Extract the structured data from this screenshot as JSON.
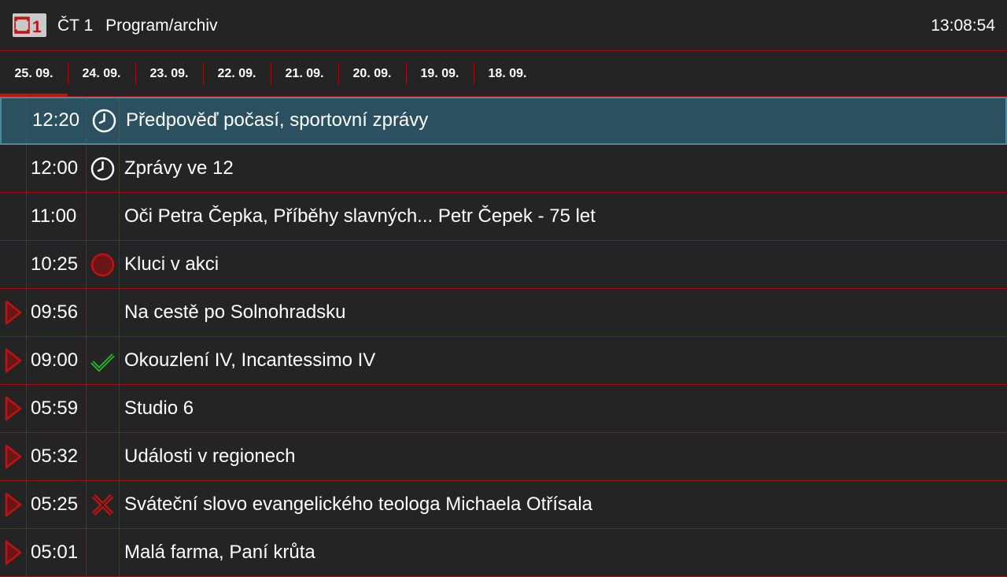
{
  "header": {
    "logo_alt": "ČT1 logo",
    "channel": "ČT 1",
    "section": "Program/archiv",
    "clock": "13:08:54"
  },
  "tabs": [
    {
      "label": "25. 09.",
      "active": true
    },
    {
      "label": "24. 09.",
      "active": false
    },
    {
      "label": "23. 09.",
      "active": false
    },
    {
      "label": "22. 09.",
      "active": false
    },
    {
      "label": "21. 09.",
      "active": false
    },
    {
      "label": "20. 09.",
      "active": false
    },
    {
      "label": "19. 09.",
      "active": false
    },
    {
      "label": "18. 09.",
      "active": false
    }
  ],
  "programs": [
    {
      "time": "12:20",
      "title": "Předpověď počasí, sportovní zprávy",
      "status": "clock-icon",
      "playable": false,
      "selected": true
    },
    {
      "time": "12:00",
      "title": "Zprávy ve 12",
      "status": "clock-icon",
      "playable": false,
      "selected": false
    },
    {
      "time": "11:00",
      "title": "Oči Petra Čepka, Příběhy slavných... Petr Čepek - 75 let",
      "status": "",
      "playable": false,
      "selected": false
    },
    {
      "time": "10:25",
      "title": "Kluci v akci",
      "status": "record-icon",
      "playable": false,
      "selected": false
    },
    {
      "time": "09:56",
      "title": "Na cestě po Solnohradsku",
      "status": "",
      "playable": true,
      "selected": false
    },
    {
      "time": "09:00",
      "title": "Okouzlení IV, Incantessimo IV",
      "status": "check-icon",
      "playable": true,
      "selected": false
    },
    {
      "time": "05:59",
      "title": "Studio 6",
      "status": "",
      "playable": true,
      "selected": false
    },
    {
      "time": "05:32",
      "title": "Události v regionech",
      "status": "",
      "playable": true,
      "selected": false
    },
    {
      "time": "05:25",
      "title": "Sváteční slovo evangelického teologa Michaela Otřísala",
      "status": "cross-icon",
      "playable": true,
      "selected": false
    },
    {
      "time": "05:01",
      "title": "Malá farma, Paní krůta",
      "status": "",
      "playable": true,
      "selected": false
    }
  ],
  "colors": {
    "background": "#242424",
    "divider": "#a01010",
    "accent": "#c41010",
    "selected_row": "#2b5161",
    "check": "#1fbf2a"
  }
}
